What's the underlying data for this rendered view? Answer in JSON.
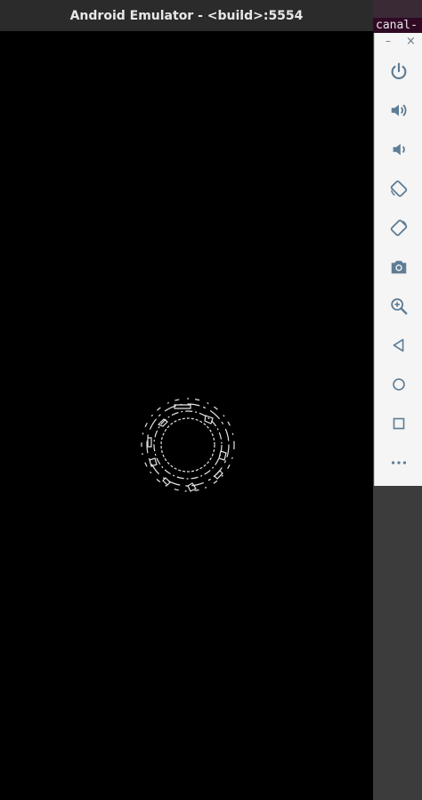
{
  "window": {
    "title": "Android Emulator - <build>:5554"
  },
  "terminal": {
    "tab_text": "canal-"
  },
  "toolbar": {
    "minimize_label": "–",
    "close_label": "×",
    "buttons": [
      {
        "name": "power-button",
        "icon": "power-icon"
      },
      {
        "name": "volume-up-button",
        "icon": "volume-up-icon"
      },
      {
        "name": "volume-down-button",
        "icon": "volume-down-icon"
      },
      {
        "name": "rotate-left-button",
        "icon": "rotate-left-icon"
      },
      {
        "name": "rotate-right-button",
        "icon": "rotate-right-icon"
      },
      {
        "name": "screenshot-button",
        "icon": "camera-icon"
      },
      {
        "name": "zoom-button",
        "icon": "zoom-in-icon"
      },
      {
        "name": "back-button",
        "icon": "back-triangle-icon"
      },
      {
        "name": "home-button",
        "icon": "home-circle-icon"
      },
      {
        "name": "overview-button",
        "icon": "overview-square-icon"
      },
      {
        "name": "more-button",
        "icon": "more-dots-icon"
      }
    ]
  },
  "colors": {
    "icon": "#5f7d95",
    "screen": "#000000",
    "titlebar": "#2b2b2b"
  }
}
